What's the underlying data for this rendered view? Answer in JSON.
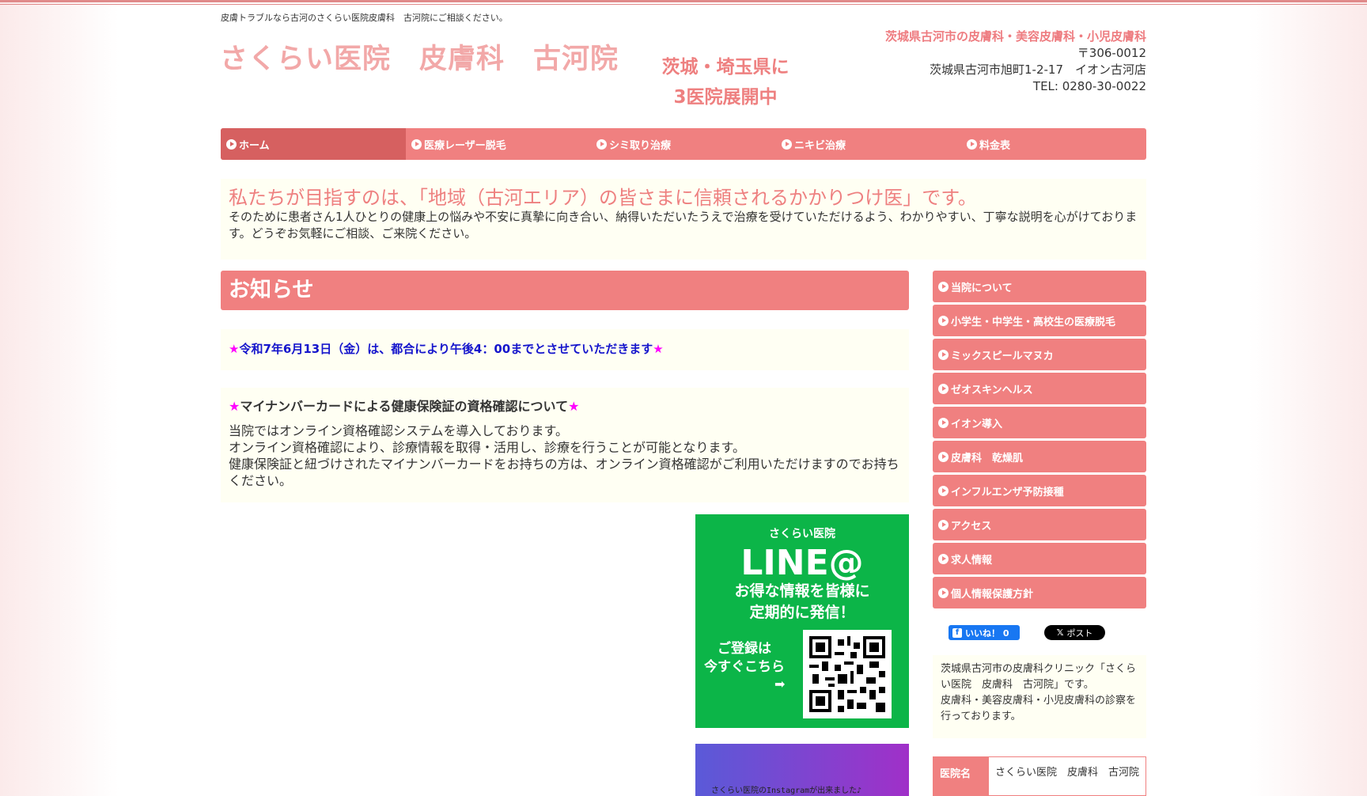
{
  "header": {
    "tagline": "皮膚トラブルなら古河のさくらい医院皮膚科　古河院にご相談ください。",
    "logo": "さくらい医院　皮膚科　古河院",
    "slogan_line1": "茨城・埼玉県に",
    "slogan_line2": "3医院展開中",
    "address_highlight": "茨城県古河市の皮膚科・美容皮膚科・小児皮膚科",
    "postal": "〒306-0012",
    "address": "茨城県古河市旭町1-2-17　イオン古河店",
    "tel": "TEL: 0280-30-0022"
  },
  "nav": {
    "items": [
      {
        "label": "ホーム"
      },
      {
        "label": "医療レーザー脱毛"
      },
      {
        "label": "シミ取り治療"
      },
      {
        "label": "ニキビ治療"
      },
      {
        "label": "料金表"
      }
    ]
  },
  "mission": {
    "title": "私たちが目指すのは、「地域（古河エリア）の皆さまに信頼されるかかりつけ医」です。",
    "body": "そのために患者さん1人ひとりの健康上の悩みや不安に真摯に向き合い、納得いただいたうえで治療を受けていただけるよう、わかりやすい、丁寧な説明を心がけております。どうぞお気軽にご相談、ご来院ください。"
  },
  "news": {
    "heading": "お知らせ",
    "star": "★",
    "item1": "令和7年6月13日（金）は、都合により午後4：00までとさせていただきます",
    "item2_title": "マイナンバーカードによる健康保険証の資格確認について",
    "item2_line1": "当院ではオンライン資格確認システムを導入しております。",
    "item2_line2": "オンライン資格確認により、診療情報を取得・活用し、診療を行うことが可能となります。",
    "item2_line3": "健康保険証と紐づけされたマイナンバーカードをお持ちの方は、オンライン資格確認がご利用いただけますのでお持ちください。"
  },
  "line_banner": {
    "clinic": "さくらい医院",
    "brand": "LINE@",
    "msg1": "お得な情報を皆様に",
    "msg2": "定期的に発信！",
    "reg1": "ご登録は",
    "reg2": "今すぐこちら",
    "arrow": "➡"
  },
  "insta_banner": {
    "text": "さくらい医院のInstagramが出来ました♪"
  },
  "sidebar": {
    "items": [
      {
        "label": "当院について"
      },
      {
        "label": "小学生・中学生・高校生の医療脱毛"
      },
      {
        "label": "ミックスピールマヌカ"
      },
      {
        "label": "ゼオスキンヘルス"
      },
      {
        "label": "イオン導入"
      },
      {
        "label": "皮膚科　乾燥肌"
      },
      {
        "label": "インフルエンザ予防接種"
      },
      {
        "label": "アクセス"
      },
      {
        "label": "求人情報"
      },
      {
        "label": "個人情報保護方針"
      }
    ],
    "desc_line1": "茨城県古河市の皮膚科クリニック「さくらい医院　皮膚科　古河院」です。",
    "desc_line2": "皮膚科・美容皮膚科・小児皮膚科の診察を行っております。",
    "table_head": "医院名",
    "table_value": "さくらい医院　皮膚科　古河院"
  },
  "social": {
    "fb_icon": "f",
    "fb_label": "いいね！ 0",
    "x_icon": "𝕏",
    "x_label": "ポスト"
  },
  "colors": {
    "accent": "#f08080",
    "accent_dark": "#d66060",
    "cream": "#fffff3",
    "line_green": "#0cb548",
    "news_blue": "#1515cc",
    "star_magenta": "#ff00ff"
  }
}
